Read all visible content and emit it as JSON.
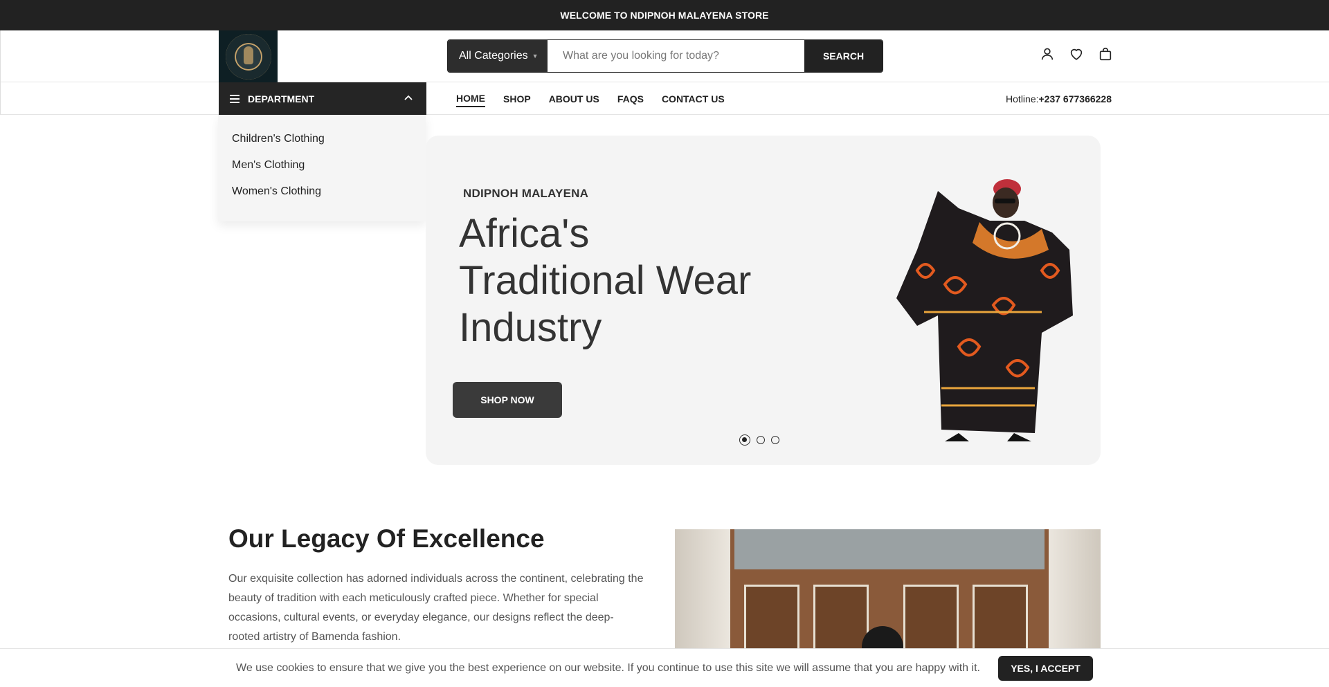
{
  "topbar": {
    "text": "WELCOME TO NDIPNOH MALAYENA STORE"
  },
  "header": {
    "logo_icon": "brand-logo",
    "search": {
      "category_label": "All Categories",
      "placeholder": "What are you looking for today?",
      "value": "",
      "button_label": "SEARCH"
    },
    "icons": [
      "user-icon",
      "heart-icon",
      "bag-icon"
    ]
  },
  "nav": {
    "department_label": "DEPARTMENT",
    "links": [
      {
        "label": "HOME",
        "active": true
      },
      {
        "label": "SHOP",
        "active": false
      },
      {
        "label": "ABOUT US",
        "active": false
      },
      {
        "label": "FAQS",
        "active": false
      },
      {
        "label": "CONTACT US",
        "active": false
      }
    ],
    "hotline_label": "Hotline:",
    "hotline_number": "+237 677366228"
  },
  "department_menu": {
    "items": [
      "Children's Clothing",
      "Men's Clothing",
      "Women's Clothing"
    ]
  },
  "hero": {
    "brand": "NDIPNOH MALAYENA",
    "title": "Africa's Traditional Wear Industry",
    "button_label": "SHOP NOW",
    "slides_count": 3,
    "active_slide": 1
  },
  "legacy": {
    "title": "Our Legacy Of Excellence",
    "text": "Our exquisite collection has adorned individuals across the continent, celebrating the beauty of tradition with each meticulously crafted piece. Whether for special occasions, cultural events, or everyday elegance, our designs reflect the deep-rooted artistry of Bamenda fashion."
  },
  "cookie": {
    "text": "We use cookies to ensure that we give you the best experience on our website. If you continue to use this site we will assume that you are happy with it.",
    "button_label": "YES, I ACCEPT"
  },
  "colors": {
    "dark": "#222222",
    "hero_bg": "#f4f4f4",
    "text_muted": "#555555"
  }
}
